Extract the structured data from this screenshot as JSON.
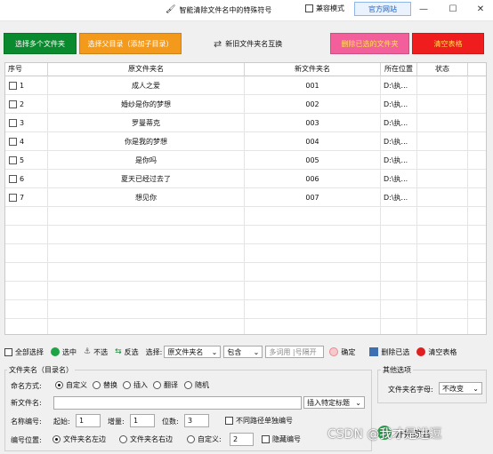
{
  "titlebar": {
    "title": "智能清除文件名中的特殊符号",
    "compat_label": "兼容模式",
    "official_site": "官方网站",
    "minimize": "—",
    "maximize": "☐",
    "close": "✕"
  },
  "top_buttons": {
    "select_multi": "选择多个文件夹",
    "select_parent": "选择父目录（添加子目录）",
    "swap_names": "新旧文件夹名互换",
    "delete_selected": "删除已选的文件夹",
    "clear_table": "清空表格"
  },
  "colors": {
    "green": "#0a8a2e",
    "orange": "#f39a1c",
    "pink": "#f25f9a",
    "red": "#ef1d1d"
  },
  "table": {
    "headers": [
      "序号",
      "原文件夹名",
      "新文件夹名",
      "所在位置",
      "状态"
    ],
    "rows": [
      {
        "idx": "1",
        "orig": "成人之爱",
        "new": "001",
        "loc": "D:\\执...",
        "status": ""
      },
      {
        "idx": "2",
        "orig": "婚纱是你的梦想",
        "new": "002",
        "loc": "D:\\执...",
        "status": ""
      },
      {
        "idx": "3",
        "orig": "罗曼蒂克",
        "new": "003",
        "loc": "D:\\执...",
        "status": ""
      },
      {
        "idx": "4",
        "orig": "你是我的梦想",
        "new": "004",
        "loc": "D:\\执...",
        "status": ""
      },
      {
        "idx": "5",
        "orig": "是你吗",
        "new": "005",
        "loc": "D:\\执...",
        "status": ""
      },
      {
        "idx": "6",
        "orig": "夏天已经过去了",
        "new": "006",
        "loc": "D:\\执...",
        "status": ""
      },
      {
        "idx": "7",
        "orig": "想见你",
        "new": "007",
        "loc": "D:\\执...",
        "status": ""
      }
    ]
  },
  "toolbar": {
    "select_all": "全部选择",
    "check": "选中",
    "uncheck": "不选",
    "invert": "反选",
    "select_label": "选择:",
    "field_value": "原文件夹名",
    "match_value": "包含",
    "keyword_placeholder": "多词用 |号隔开",
    "confirm": "确定",
    "delete_checked": "删除已选",
    "clear_table": "清空表格"
  },
  "name_group": {
    "legend": "文件夹名（目录名）",
    "naming_mode_label": "命名方式:",
    "modes": [
      "自定义",
      "替换",
      "插入",
      "翻译",
      "随机"
    ],
    "new_name_label": "新文件名:",
    "new_name_value": "",
    "insert_title": "插入特定标题",
    "numbering_label": "名称编号:",
    "start_label": "起始:",
    "start_value": "1",
    "increment_label": "增量:",
    "increment_value": "1",
    "digits_label": "位数:",
    "digits_value": "3",
    "separate_numbering": "不同路径单独编号",
    "position_label": "编号位置:",
    "positions": [
      "文件夹名左边",
      "文件夹名右边",
      "自定义:"
    ],
    "custom_position_value": "2",
    "hide_numbering": "隐藏编号"
  },
  "other_group": {
    "legend": "其他选项",
    "case_label": "文件夹名字母:",
    "case_value": "不改变"
  },
  "start_button": "开始改名",
  "watermark": "CSDN @我才是进逗"
}
